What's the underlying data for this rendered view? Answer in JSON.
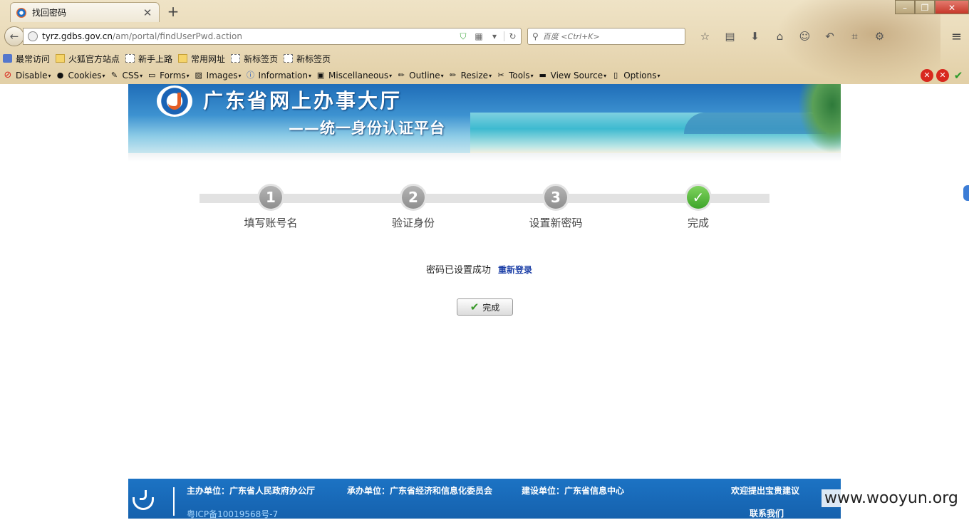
{
  "browser": {
    "tab_title": "找回密码",
    "tab_close": "✕",
    "new_tab": "+",
    "url_host": "tyrz.gdbs.gov.cn",
    "url_path": "/am/portal/findUserPwd.action",
    "search_placeholder": "百度 <Ctrl+K>",
    "bookmarks": [
      "最常访问",
      "火狐官方站点",
      "新手上路",
      "常用网址",
      "新标签页",
      "新标签页"
    ],
    "devtools": [
      "Disable",
      "Cookies",
      "CSS",
      "Forms",
      "Images",
      "Information",
      "Miscellaneous",
      "Outline",
      "Resize",
      "Tools",
      "View Source",
      "Options"
    ]
  },
  "banner": {
    "title": "广东省网上办事大厅",
    "subtitle": "——统一身份认证平台"
  },
  "steps": [
    {
      "number": "1",
      "label": "填写账号名",
      "state": "done-gray"
    },
    {
      "number": "2",
      "label": "验证身份",
      "state": "done-gray"
    },
    {
      "number": "3",
      "label": "设置新密码",
      "state": "done-gray"
    },
    {
      "number": "✓",
      "label": "完成",
      "state": "current"
    }
  ],
  "message": {
    "text": "密码已设置成功",
    "relogin_link": "重新登录"
  },
  "finish_button": "完成",
  "footer": {
    "sponsor": "主办单位：广东省人民政府办公厅",
    "organizer": "承办单位：广东省经济和信息化委员会",
    "builder": "建设单位：广东省信息中心",
    "suggestion": "欢迎提出宝贵建议",
    "icp": "粤ICP备10019568号-7",
    "contact": "联系我们"
  },
  "watermark": "www.wooyun.org",
  "colors": {
    "footer_bg": "#1c73c4",
    "step_done": "#3ea52b",
    "link": "#1b3ea6"
  }
}
